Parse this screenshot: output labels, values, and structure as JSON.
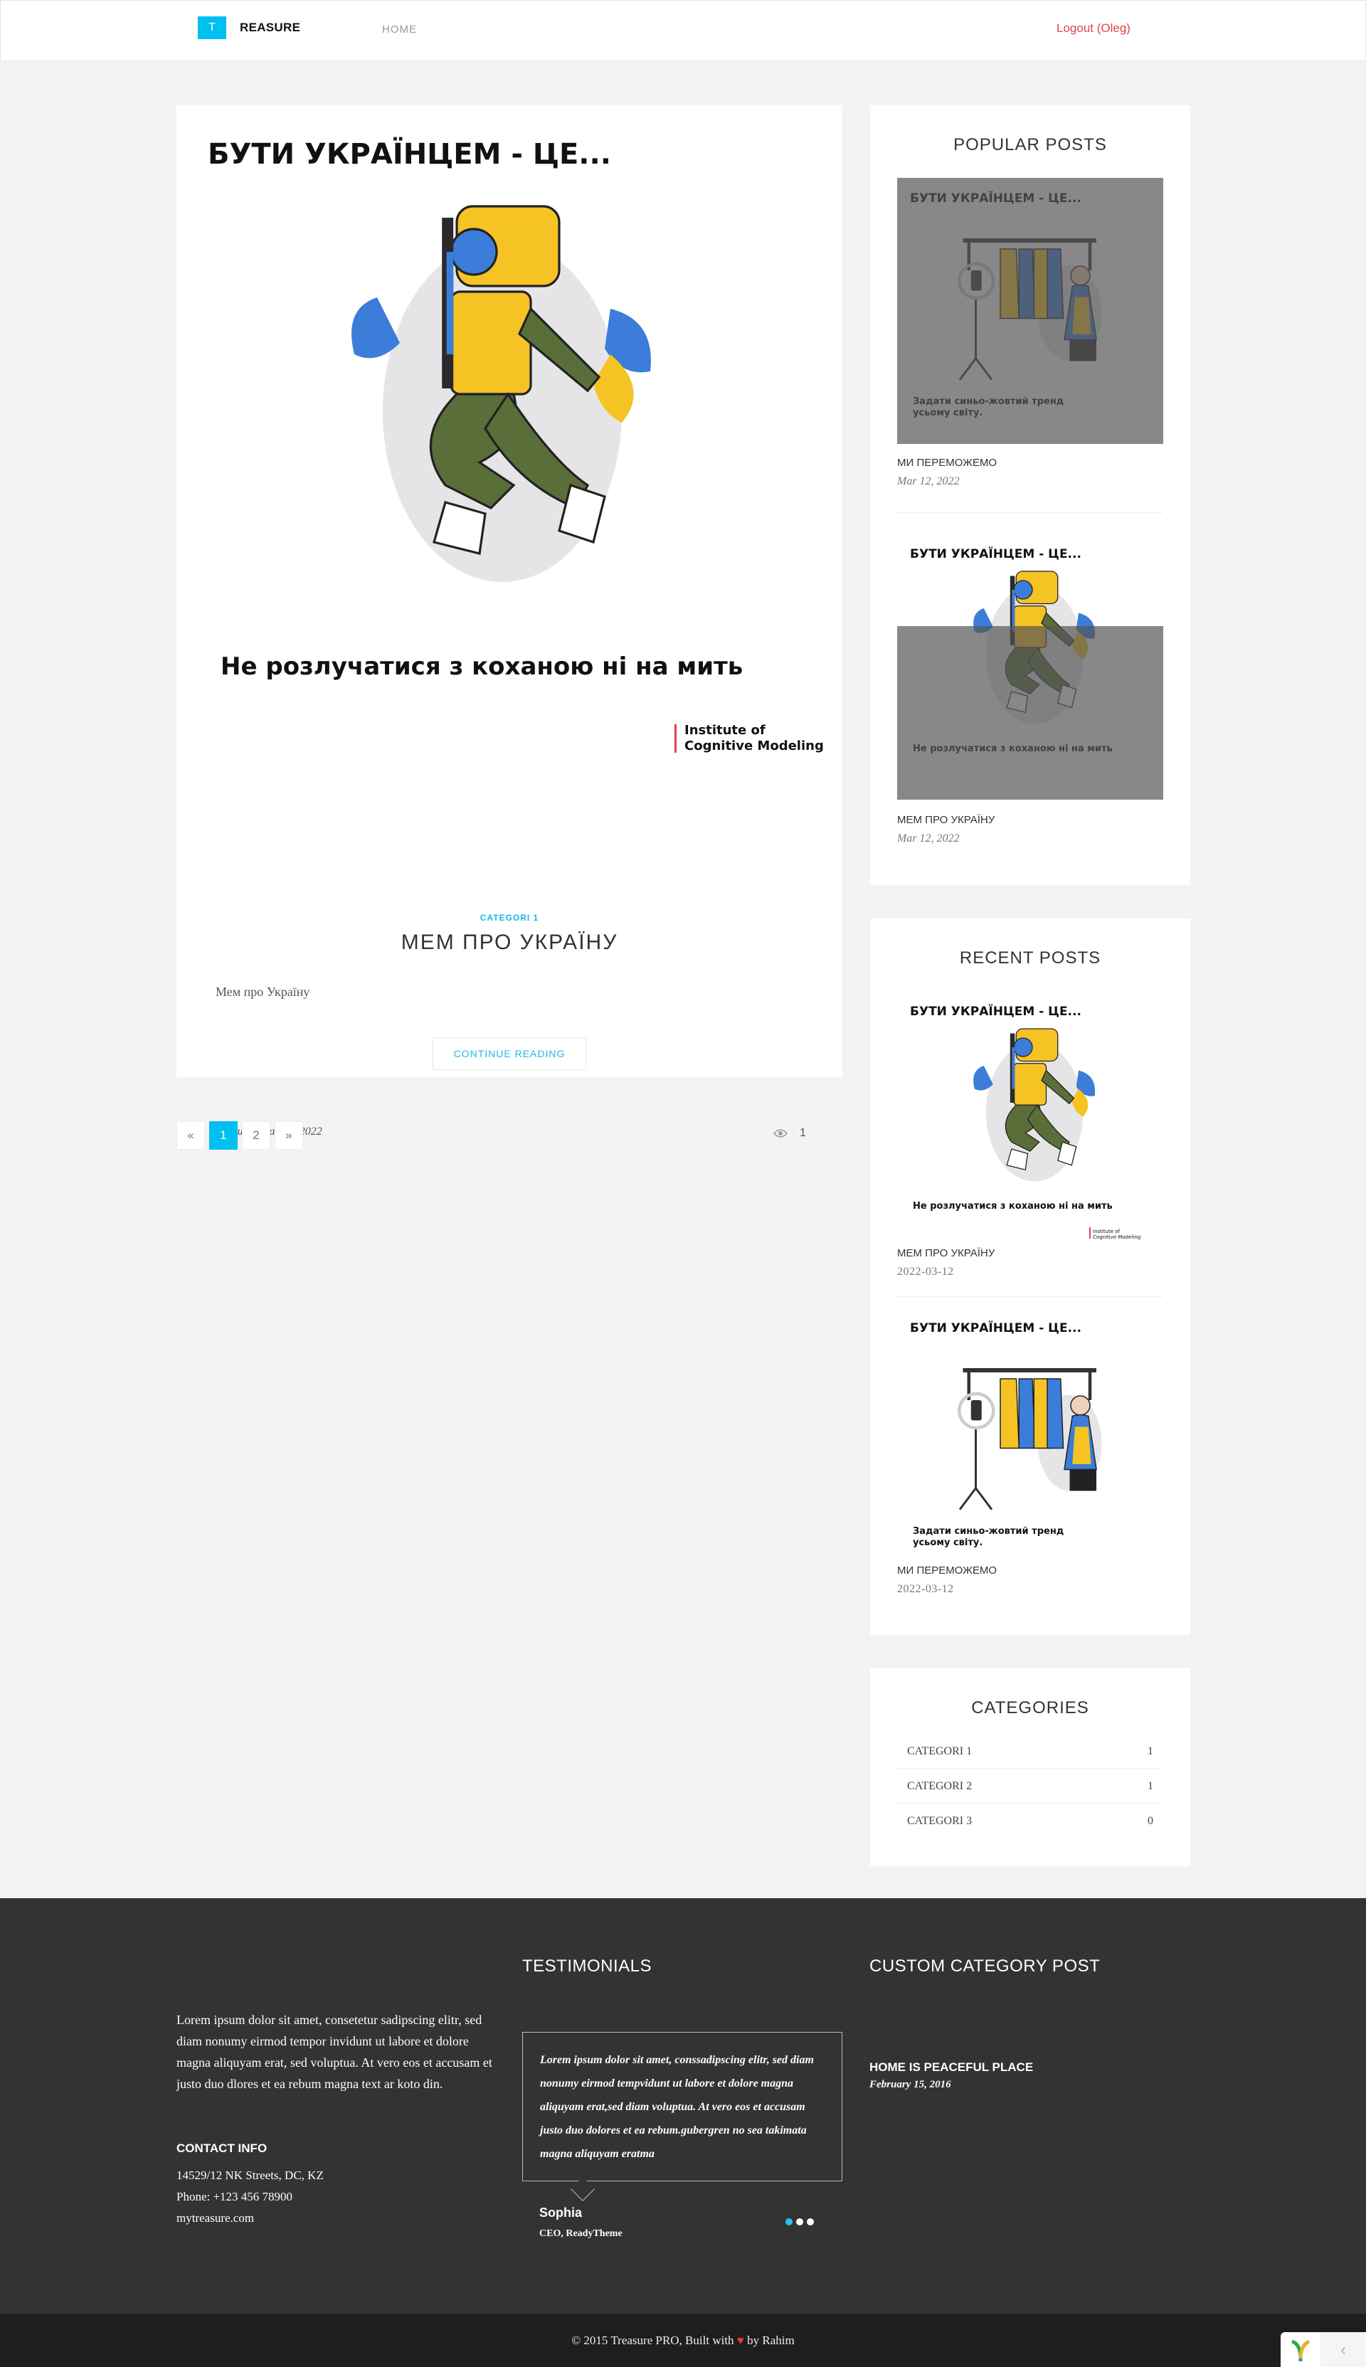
{
  "header": {
    "logo_letter": "T",
    "logo_text": "REASURE",
    "nav_home": "HOME",
    "logout": "Logout (Oleg)"
  },
  "images": {
    "main_title": "БУТИ УКРАЇНЦЕМ - ЦЕ...",
    "main_caption": "Не розлучатися з коханою ні на мить",
    "institute_line1": "Institute of",
    "institute_line2": "Cognitive Modeling",
    "trend_caption_line1": "Задати синьо-жовтий тренд",
    "trend_caption_line2": "усьому світу."
  },
  "post": {
    "category": "CATEGORI 1",
    "title": "МЕМ ПРО УКРАЇНУ",
    "excerpt": "Мем про Україну",
    "continue": "CONTINUE READING",
    "meta": "By Rubel Mar 12, 2022",
    "views": "1"
  },
  "pagination": {
    "prev": "«",
    "pages": [
      "1",
      "2"
    ],
    "next": "»",
    "active": "1"
  },
  "popular": {
    "title": "POPULAR POSTS",
    "items": [
      {
        "title": "МИ ПЕРЕМОЖЕМО",
        "date": "Mar 12, 2022"
      },
      {
        "title": "МЕМ ПРО УКРАЇНУ",
        "date": "Mar 12, 2022"
      }
    ]
  },
  "recent": {
    "title": "RECENT POSTS",
    "items": [
      {
        "title": "МЕМ ПРО УКРАЇНУ",
        "date": "2022-03-12"
      },
      {
        "title": "МИ ПЕРЕМОЖЕМО",
        "date": "2022-03-12"
      }
    ]
  },
  "categories": {
    "title": "CATEGORIES",
    "items": [
      {
        "name": "CATEGORI 1",
        "count": "1"
      },
      {
        "name": "CATEGORI 2",
        "count": "1"
      },
      {
        "name": "CATEGORI 3",
        "count": "0"
      }
    ]
  },
  "footer": {
    "about": "Lorem ipsum dolor sit amet, consetetur sadipscing elitr, sed diam nonumy eirmod tempor invidunt ut labore et dolore magna aliquyam erat, sed voluptua. At vero eos et accusam et justo duo dlores et ea rebum magna text ar koto din.",
    "contact_title": "CONTACT INFO",
    "address": "14529/12 NK Streets, DC, KZ",
    "phone": "Phone: +123 456 78900",
    "site": "mytreasure.com",
    "testimonials_title": "TESTIMONIALS",
    "quote": "Lorem ipsum dolor sit amet, conssadipscing elitr, sed diam nonumy eirmod tempvidunt ut labore et dolore magna aliquyam erat,sed diam voluptua. At vero eos et accusam justo duo dolores et ea rebum.gubergren no sea takimata magna aliquyam eratma",
    "quote_author": "Sophia",
    "quote_role": "CEO, ReadyTheme",
    "custom_title": "CUSTOM CATEGORY POST",
    "custom_post_title": "HOME IS PEACEFUL PLACE",
    "custom_post_date": "February 15, 2016",
    "copyright_pre": "© 2015 Treasure PRO, Built with",
    "copyright_post": "by Rahim"
  },
  "colors": {
    "accent": "#00c0f0",
    "logout": "#e04545",
    "footer_bg": "#333333",
    "copy_bg": "#1e1e1e",
    "ua_blue": "#3b7dd8",
    "ua_yellow": "#f6c325"
  },
  "icons": {
    "views": "eye-icon",
    "heart": "heart-icon",
    "debug": "yii-logo-icon"
  }
}
